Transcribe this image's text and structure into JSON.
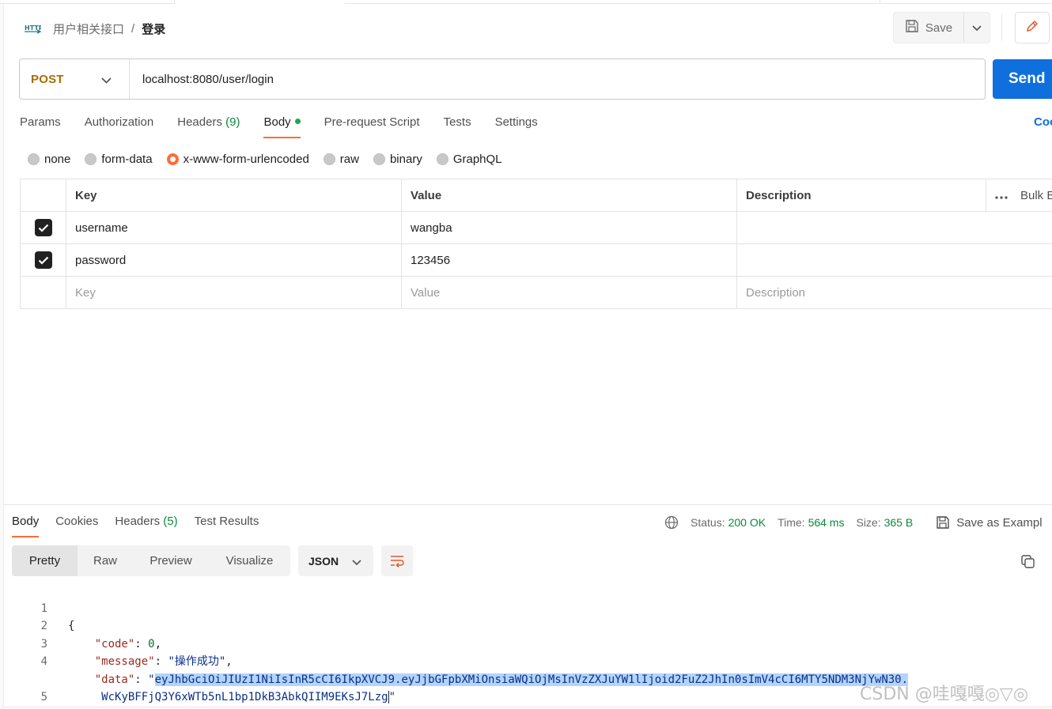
{
  "breadcrumb": {
    "icon": "http-icon",
    "parent": "用户相关接口",
    "separator": "/",
    "current": "登录"
  },
  "header": {
    "save_label": "Save"
  },
  "request": {
    "method": "POST",
    "url": "localhost:8080/user/login",
    "send_label": "Send",
    "tabs": [
      {
        "label": "Params"
      },
      {
        "label": "Authorization"
      },
      {
        "label": "Headers",
        "count": "(9)"
      },
      {
        "label": "Body"
      },
      {
        "label": "Pre-request Script"
      },
      {
        "label": "Tests"
      },
      {
        "label": "Settings"
      }
    ],
    "active_tab": "Body",
    "code_link": "Coo",
    "body_types": [
      "none",
      "form-data",
      "x-www-form-urlencoded",
      "raw",
      "binary",
      "GraphQL"
    ],
    "selected_body_type": "x-www-form-urlencoded",
    "table": {
      "headers": {
        "key": "Key",
        "value": "Value",
        "description": "Description",
        "bulk": "Bulk E"
      },
      "rows": [
        {
          "checked": true,
          "key": "username",
          "value": "wangba",
          "description": ""
        },
        {
          "checked": true,
          "key": "password",
          "value": "123456",
          "description": ""
        }
      ],
      "placeholder": {
        "key": "Key",
        "value": "Value",
        "description": "Description"
      }
    }
  },
  "response": {
    "tabs": [
      {
        "label": "Body"
      },
      {
        "label": "Cookies"
      },
      {
        "label": "Headers",
        "count": "(5)"
      },
      {
        "label": "Test Results"
      }
    ],
    "active_tab": "Body",
    "status": {
      "label": "Status:",
      "value": "200 OK"
    },
    "time": {
      "label": "Time:",
      "value": "564 ms"
    },
    "size": {
      "label": "Size:",
      "value": "365 B"
    },
    "save_example": "Save as Exampl",
    "view_tabs": [
      "Pretty",
      "Raw",
      "Preview",
      "Visualize"
    ],
    "active_view": "Pretty",
    "format": "JSON",
    "code": {
      "line_numbers": [
        "1",
        "2",
        "3",
        "4",
        "5"
      ],
      "open_brace": "{",
      "close_brace": "}",
      "code_key": "\"code\"",
      "code_value": "0",
      "message_key": "\"message\"",
      "message_value": "\"操作成功\"",
      "data_key": "\"data\"",
      "data_value_part1": "eyJhbGciOiJIUzI1NiIsInR5cCI6IkpXVCJ9.eyJjbGFpbXMiOnsiaWQiOjMsInVzZXJuYW1lIjoid2FuZ2JhIn0sImV4cCI6MTY5NDM3NjYwN30.",
      "data_value_part2": "WcKyBFFjQ3Y6xWTb5nL1bp1DkB3AbkQIIM9EKsJ7Lzg"
    }
  },
  "watermark": "CSDN @哇嘎嘎◎▽◎"
}
